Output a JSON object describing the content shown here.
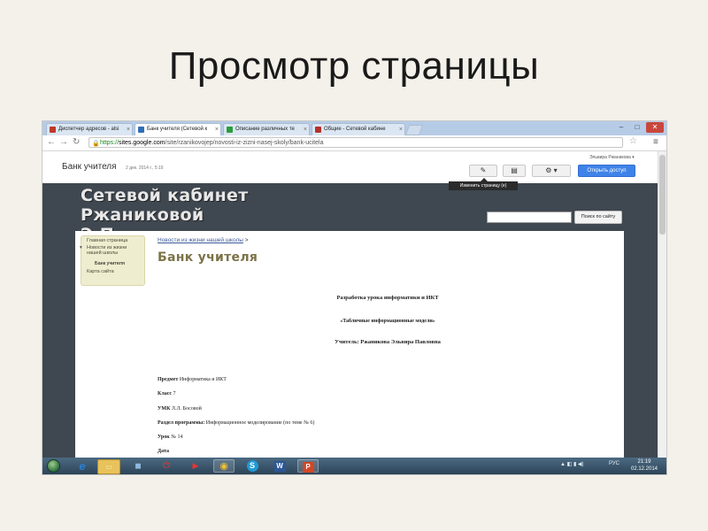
{
  "slide": {
    "title": "Просмотр страницы"
  },
  "browser": {
    "tabs": [
      {
        "label": "Диспетчер адресов - alsi",
        "favicon_color": "#c0392b"
      },
      {
        "label": "Банк учителя (Сетевой к",
        "favicon_color": "#2f6fb5"
      },
      {
        "label": "Описание различных те",
        "favicon_color": "#2a9d3a"
      },
      {
        "label": "Общие - Сетевой кабине",
        "favicon_color": "#b5322a"
      }
    ],
    "window_controls": {
      "minimize": "–",
      "maximize": "□",
      "close": "✕"
    },
    "nav": {
      "back": "←",
      "forward": "→",
      "reload": "↻"
    },
    "url": {
      "scheme": "https://",
      "domain": "sites.google.com",
      "path": "/site/rzanikovojep/novosti-iz-zizni-nasej-skoly/bank-ucitela"
    },
    "icons": {
      "lock": "lock-icon",
      "star": "star-icon",
      "menu": "menu-icon"
    }
  },
  "site": {
    "name": "Банк учителя",
    "date": "2 дек. 2014 г., 5:19",
    "user": "Эльвира Ржаникова ▾",
    "buttons": {
      "edit": "✎",
      "page": "▤",
      "settings": "⚙ ▾",
      "share": "Открыть доступ"
    },
    "tooltip": "Изменить страницу (e)",
    "banner_line1": "Сетевой кабинет Ржаниковой",
    "banner_line2": "Э.П.",
    "search_placeholder": "",
    "search_button": "Поиск по сайту",
    "sidebar": {
      "home": "Главная страница",
      "news_line1": "Новости из жизни",
      "news_line2": "нашей школы",
      "current": "Банк учителя",
      "sitemap": "Карта сайта",
      "expand": "▾"
    },
    "breadcrumb": {
      "link": "Новости из жизни нашей школы",
      "sep": " >"
    },
    "page_title": "Банк учителя"
  },
  "document": {
    "heading": "Разработка урока информатики и ИКТ",
    "subheading": "«Табличные информационные модели»",
    "teacher": "Учитель: Ржаникова Эльвира Павловна",
    "fields": [
      {
        "label": "Предмет",
        "value": "Информатика и ИКТ"
      },
      {
        "label": "Класс",
        "value": "7"
      },
      {
        "label": "УМК",
        "value": "Л.Л. Босовой"
      },
      {
        "label": "Раздел программы:",
        "value": "Информационное моделирование (по теме № 6)"
      },
      {
        "label": "Урок",
        "value": "№ 14"
      },
      {
        "label": "Дата",
        "value": ""
      }
    ]
  },
  "taskbar": {
    "apps": [
      {
        "icon": "internet-explorer-icon",
        "glyph": "e",
        "color": "#2a7fd4"
      },
      {
        "icon": "folder-icon",
        "glyph": "▭",
        "color": "#e8c25a"
      },
      {
        "icon": "media-icon",
        "glyph": "◼",
        "color": "#3b6fa0"
      },
      {
        "icon": "power-icon",
        "glyph": "⏻",
        "color": "#d42020"
      },
      {
        "icon": "video-icon",
        "glyph": "▶",
        "color": "#5b86b8"
      },
      {
        "icon": "chrome-icon",
        "glyph": "◉",
        "color": "#e0a52b"
      },
      {
        "icon": "skype-icon",
        "glyph": "S",
        "color": "#1f9ad6"
      },
      {
        "icon": "word-icon",
        "glyph": "W",
        "color": "#2b5797"
      },
      {
        "icon": "presentation-icon",
        "glyph": "P",
        "color": "#d24726"
      }
    ],
    "tray_language": "РУС",
    "tray_icons": "▲ ◧ ▮ ◀)",
    "time": "21:19",
    "date": "02.12.2014"
  }
}
